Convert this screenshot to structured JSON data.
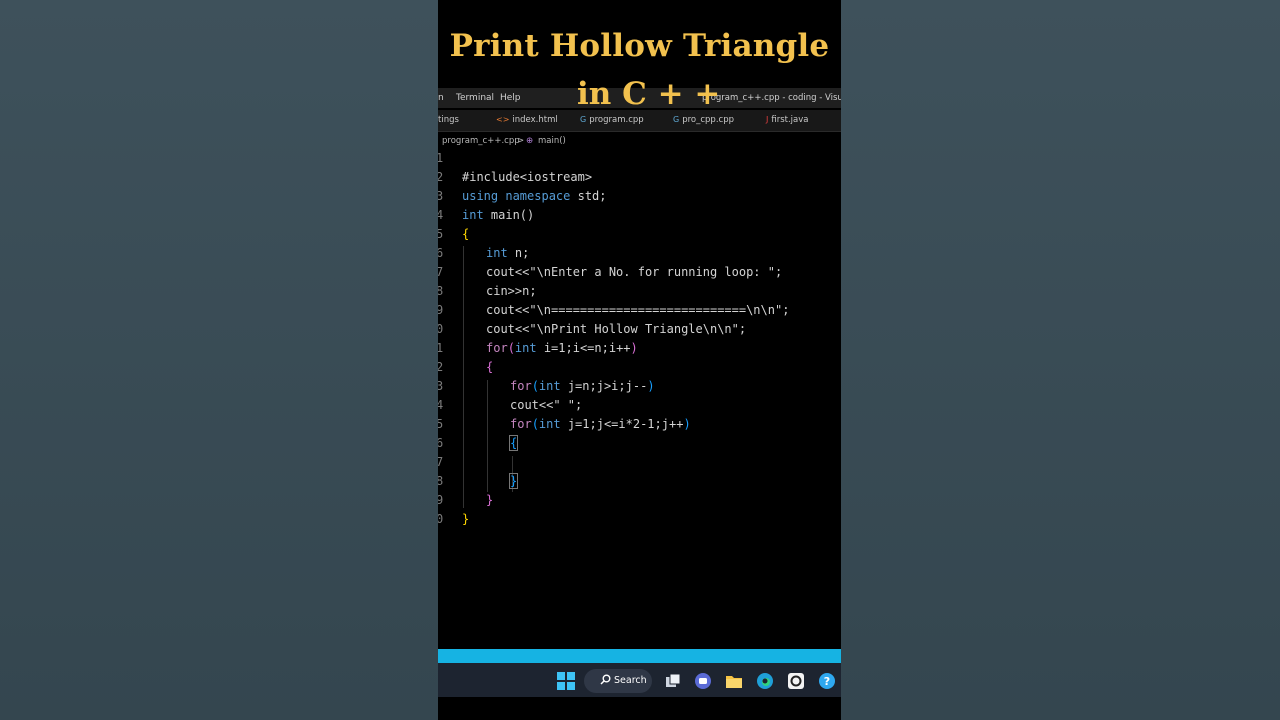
{
  "video_title": {
    "line1": "Print Hollow Triangle",
    "line2": "in C + +"
  },
  "menubar": {
    "items": [
      "n",
      "Terminal",
      "Help"
    ],
    "window_title": "program_c++.cpp - coding - Visual S"
  },
  "tabs": [
    {
      "label": "tings"
    },
    {
      "label": "index.html",
      "icon": "html-icon"
    },
    {
      "label": "program.cpp",
      "icon": "cpp-icon"
    },
    {
      "label": "pro_cpp.cpp",
      "icon": "cpp-icon"
    },
    {
      "label": "first.java",
      "icon": "java-icon"
    }
  ],
  "breadcrumb": {
    "file": "program_c++.cpp",
    "separator": ">",
    "symbol": "main()"
  },
  "line_numbers": [
    "1",
    "2",
    "3",
    "4",
    "5",
    "6",
    "7",
    "8",
    "9",
    "0",
    "1",
    "2",
    "3",
    "4",
    "5",
    "6",
    "7",
    "8",
    "9",
    "0"
  ],
  "code": {
    "l2": "#include<iostream>",
    "l3a": "using",
    "l3b": " namespace",
    "l3c": " std;",
    "l4a": "int",
    "l4b": " main()",
    "l5": "{",
    "l6a": "int",
    "l6b": " n;",
    "l7": "cout<<\"\\nEnter a No. for running loop: \";",
    "l8": "cin>>n;",
    "l9": "cout<<\"\\n===========================\\n\\n\";",
    "l10": "cout<<\"\\nPrint Hollow Triangle\\n\\n\";",
    "l11a": "for",
    "l11b": "(",
    "l11c": "int",
    "l11d": " i=1;i<=n;i++",
    "l11e": ")",
    "l12": "{",
    "l13a": "for",
    "l13b": "(",
    "l13c": "int",
    "l13d": " j=n;j>i;j--",
    "l13e": ")",
    "l14": "cout<<\" \";",
    "l15a": "for",
    "l15b": "(",
    "l15c": "int",
    "l15d": " j=1;j<=i*2-1;j++",
    "l15e": ")",
    "l16": "{",
    "l18": "}",
    "l19": "}",
    "l20": "}"
  },
  "taskbar": {
    "search_label": "Search"
  },
  "colors": {
    "title": "#f2c14e",
    "strip": "#16b3e3",
    "keyword": "#569cd6",
    "control": "#c586c0"
  }
}
